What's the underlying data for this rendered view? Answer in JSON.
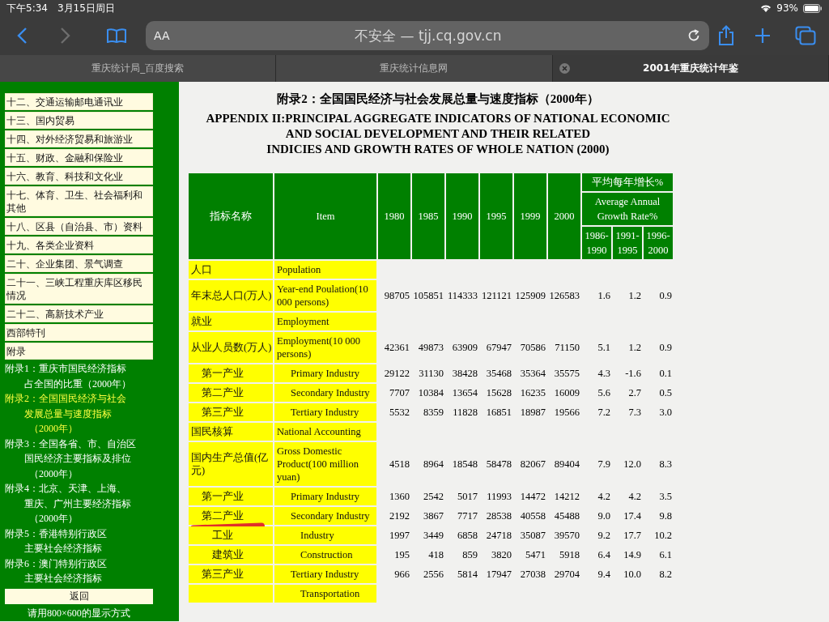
{
  "status_bar": {
    "time": "下午5:34",
    "date": "3月15日周日",
    "battery": "93%"
  },
  "toolbar": {
    "text_size": "AA",
    "address": "不安全 — tjj.cq.gov.cn"
  },
  "tabs": [
    {
      "label": "重庆统计局_百度搜索",
      "selected": false
    },
    {
      "label": "重庆统计信息网",
      "selected": false
    },
    {
      "label": "2001年重庆统计年鉴",
      "selected": true
    }
  ],
  "sidebar": {
    "items": [
      {
        "kind": "box",
        "label": "十二、交通运输邮电通讯业"
      },
      {
        "kind": "box",
        "label": "十三、国内贸易"
      },
      {
        "kind": "box",
        "label": "十四、对外经济贸易和旅游业"
      },
      {
        "kind": "box",
        "label": "十五、财政、金融和保险业"
      },
      {
        "kind": "box",
        "label": "十六、教育、科技和文化业"
      },
      {
        "kind": "box",
        "label": "十七、体育、卫生、社会福利和其他"
      },
      {
        "kind": "box",
        "label": "十八、区县（自治县、市）资料"
      },
      {
        "kind": "box",
        "label": "十九、各类企业资料"
      },
      {
        "kind": "box",
        "label": "二十、企业集团、景气调查"
      },
      {
        "kind": "box",
        "label": "二十一、三峡工程重庆库区移民情况"
      },
      {
        "kind": "box",
        "label": "二十二、高新技术产业"
      },
      {
        "kind": "box",
        "label": "西部特刊"
      },
      {
        "kind": "box",
        "label": "附录"
      },
      {
        "kind": "link",
        "selected": false,
        "lines": [
          "附录1：重庆市国民经济指标",
          "占全国的比重（2000年）"
        ]
      },
      {
        "kind": "link",
        "selected": true,
        "lines": [
          "附录2：全国国民经济与社会",
          "发展总量与速度指标",
          "（2000年）"
        ]
      },
      {
        "kind": "link",
        "selected": false,
        "lines": [
          "附录3：全国各省、市、自治区",
          "国民经济主要指标及排位",
          "（2000年）"
        ]
      },
      {
        "kind": "link",
        "selected": false,
        "lines": [
          "附录4：北京、天津、上海、",
          "重庆、广州主要经济指标",
          "（2000年）"
        ]
      },
      {
        "kind": "link",
        "selected": false,
        "lines": [
          "附录5：香港特别行政区",
          "主要社会经济指标"
        ]
      },
      {
        "kind": "link",
        "selected": false,
        "lines": [
          "附录6：澳门特别行政区",
          "主要社会经济指标"
        ]
      }
    ],
    "return_button": "返回",
    "note": "请用800×600的显示方式"
  },
  "title_cn": "附录2：全国国民经济与社会发展总量与速度指标（2000年）",
  "title_en": [
    "APPENDIX II:PRINCIPAL AGGREGATE INDICATORS OF NATIONAL ECONOMIC",
    "AND SOCIAL DEVELOPMENT AND THEIR RELATED",
    "INDICIES AND GROWTH RATES OF WHOLE NATION (2000)"
  ],
  "table": {
    "name_header": "指标名称",
    "item_header": "Item",
    "years": [
      "1980",
      "1985",
      "1990",
      "1995",
      "1999",
      "2000"
    ],
    "growth_header_cn": "平均每年增长%",
    "growth_header_en": "Average Annual Growth Rate%",
    "periods": [
      "1986-1990",
      "1991-1995",
      "1996-2000"
    ],
    "rows": [
      {
        "name": "人口",
        "item": "Population"
      },
      {
        "name": "年末总人口(万人)",
        "item": "Year-end Poulation(10 000 persons)",
        "values": [
          "98705",
          "105851",
          "114333",
          "121121",
          "125909",
          "126583",
          "1.6",
          "1.2",
          "0.9"
        ]
      },
      {
        "name": "就业",
        "item": "Employment"
      },
      {
        "name": "从业人员数(万人)",
        "item": "Employment(10 000 persons)",
        "values": [
          "42361",
          "49873",
          "63909",
          "67947",
          "70586",
          "71150",
          "5.1",
          "1.2",
          "0.9"
        ],
        "children": [
          {
            "name": "第一产业",
            "item": "Primary Industry",
            "values": [
              "29122",
              "31130",
              "38428",
              "35468",
              "35364",
              "35575",
              "4.3",
              "-1.6",
              "0.1"
            ]
          },
          {
            "name": "第二产业",
            "item": "Secondary Industry",
            "values": [
              "7707",
              "10384",
              "13654",
              "15628",
              "16235",
              "16009",
              "5.6",
              "2.7",
              "0.5"
            ]
          },
          {
            "name": "第三产业",
            "item": "Tertiary Industry",
            "values": [
              "5532",
              "8359",
              "11828",
              "16851",
              "18987",
              "19566",
              "7.2",
              "7.3",
              "3.0"
            ]
          }
        ]
      },
      {
        "name": "国民核算",
        "item": "National Accounting"
      },
      {
        "name": "国内生产总值(亿元)",
        "item": "Gross Domestic Product(100 million yuan)",
        "values": [
          "4518",
          "8964",
          "18548",
          "58478",
          "82067",
          "89404",
          "7.9",
          "12.0",
          "8.3"
        ],
        "children": [
          {
            "name": "第一产业",
            "item": "Primary Industry",
            "values": [
              "1360",
              "2542",
              "5017",
              "11993",
              "14472",
              "14212",
              "4.2",
              "4.2",
              "3.5"
            ]
          },
          {
            "name": "第二产业",
            "item": "Secondary Industry",
            "values": [
              "2192",
              "3867",
              "7717",
              "28538",
              "40558",
              "45488",
              "9.0",
              "17.4",
              "9.8"
            ],
            "children": [
              {
                "name": "工业",
                "item": "Industry",
                "values": [
                  "1997",
                  "3449",
                  "6858",
                  "24718",
                  "35087",
                  "39570",
                  "9.2",
                  "17.7",
                  "10.2"
                ]
              },
              {
                "name": "建筑业",
                "item": "Construction",
                "values": [
                  "195",
                  "418",
                  "859",
                  "3820",
                  "5471",
                  "5918",
                  "6.4",
                  "14.9",
                  "6.1"
                ]
              }
            ]
          },
          {
            "name": "第三产业",
            "item": "Tertiary Industry",
            "values": [
              "966",
              "2556",
              "5814",
              "17947",
              "27038",
              "29704",
              "9.4",
              "10.0",
              "8.2"
            ],
            "children": [
              {
                "item": "Transportation"
              }
            ]
          }
        ]
      }
    ]
  }
}
